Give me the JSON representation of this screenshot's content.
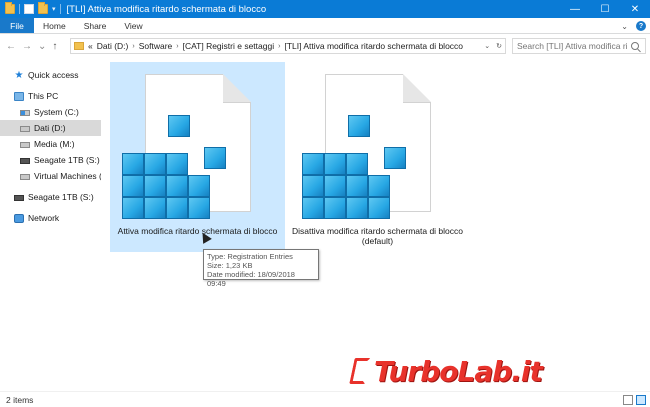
{
  "window": {
    "title": "[TLI] Attiva modifica ritardo schermata di blocco",
    "minimize": "—",
    "maximize": "☐",
    "close": "✕"
  },
  "ribbon": {
    "tabs": [
      {
        "label": "File"
      },
      {
        "label": "Home"
      },
      {
        "label": "Share"
      },
      {
        "label": "View"
      }
    ],
    "help": "?"
  },
  "nav": {
    "back": "←",
    "forward": "→",
    "history": "⌄",
    "up": "↑"
  },
  "address": {
    "overflow": "«",
    "crumbs": [
      {
        "label": "Dati (D:)"
      },
      {
        "label": "Software"
      },
      {
        "label": "[CAT] Registri e settaggi"
      },
      {
        "label": "[TLI] Attiva modifica ritardo schermata di blocco"
      }
    ]
  },
  "search": {
    "placeholder": "Search [TLI] Attiva modifica ritar..."
  },
  "sidebar": {
    "items": [
      {
        "label": "Quick access",
        "icon": "star-icon"
      },
      {
        "label": "This PC",
        "icon": "computer-icon"
      },
      {
        "label": "System (C:)",
        "icon": "drive-icon"
      },
      {
        "label": "Dati (D:)",
        "icon": "drive-icon"
      },
      {
        "label": "Media (M:)",
        "icon": "drive-icon"
      },
      {
        "label": "Seagate 1TB (S:)",
        "icon": "usb-drive-icon"
      },
      {
        "label": "Virtual Machines (V:",
        "icon": "drive-icon"
      },
      {
        "label": "Seagate 1TB (S:)",
        "icon": "usb-drive-icon"
      },
      {
        "label": "Network",
        "icon": "network-icon"
      }
    ]
  },
  "files": [
    {
      "name": "Attiva modifica ritardo schermata di blocco",
      "icon": "registry-file-icon",
      "selected": true
    },
    {
      "name": "Disattiva modifica ritardo schermata di blocco (default)",
      "icon": "registry-file-icon",
      "selected": false
    }
  ],
  "tooltip": {
    "type": "Type: Registration Entries",
    "size": "Size: 1,23 KB",
    "modified": "Date modified: 18/09/2018 09:49"
  },
  "watermark": {
    "text": "TurboLab.it"
  },
  "status": {
    "count": "2 items"
  },
  "colors": {
    "titlebar": "#0a7bd6",
    "file_tab": "#1979ca",
    "selection": "#cce8ff",
    "registry_cube": "#27a7e4",
    "watermark": "#e8322b"
  }
}
